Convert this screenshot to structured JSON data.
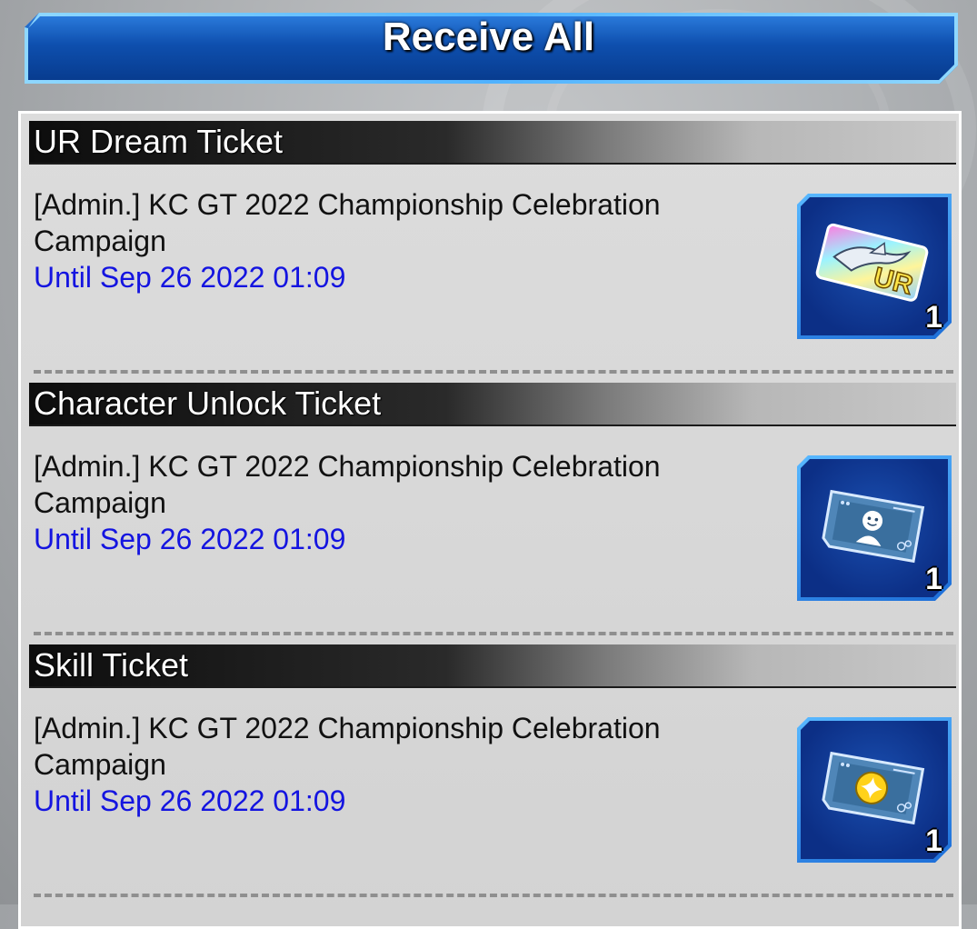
{
  "header": {
    "receive_all_label": "Receive All"
  },
  "items": [
    {
      "name": "UR Dream Ticket",
      "description": "[Admin.] KC GT 2022 Championship Celebration Campaign",
      "until": "Until Sep 26 2022 01:09",
      "icon": "ur-dream-ticket-icon",
      "count": "1"
    },
    {
      "name": "Character Unlock Ticket",
      "description": "[Admin.] KC GT 2022 Championship Celebration Campaign",
      "until": "Until Sep 26 2022 01:09",
      "icon": "character-unlock-ticket-icon",
      "count": "1"
    },
    {
      "name": "Skill Ticket",
      "description": "[Admin.] KC GT 2022 Championship Celebration Campaign",
      "until": "Until Sep 26 2022 01:09",
      "icon": "skill-ticket-icon",
      "count": "1"
    }
  ],
  "colors": {
    "accent_blue": "#0e4fae",
    "until_text": "#1414e0"
  }
}
